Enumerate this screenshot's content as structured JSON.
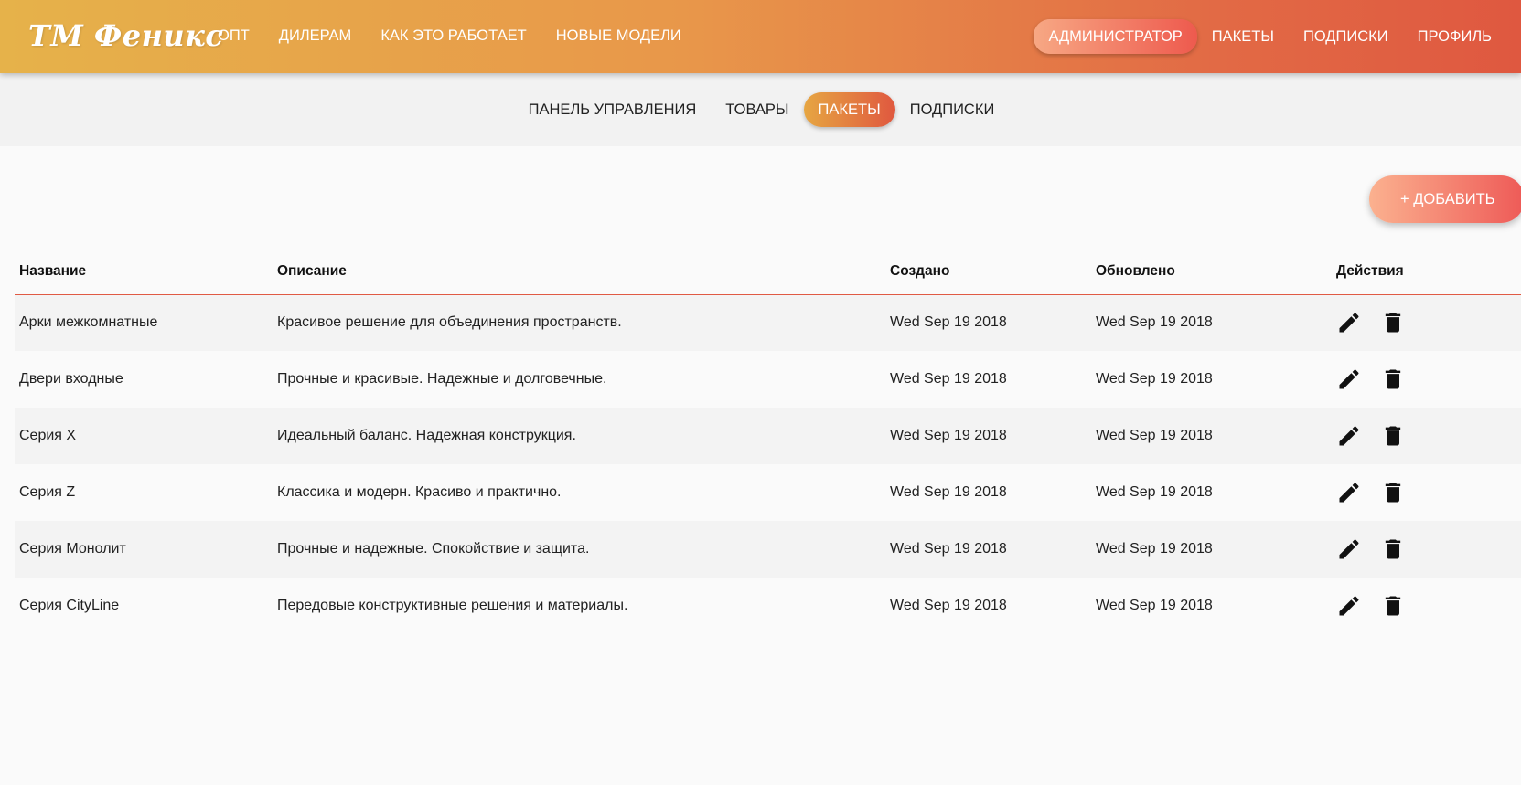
{
  "header": {
    "logo": "ТМ Феникс",
    "nav_left": [
      {
        "label": "ОПТ"
      },
      {
        "label": "ДИЛЕРАМ"
      },
      {
        "label": "КАК ЭТО РАБОТАЕТ"
      },
      {
        "label": "НОВЫЕ МОДЕЛИ"
      }
    ],
    "nav_right": [
      {
        "label": "АДМИНИСТРАТОР",
        "active": true
      },
      {
        "label": "ПАКЕТЫ"
      },
      {
        "label": "ПОДПИСКИ"
      },
      {
        "label": "ПРОФИЛЬ"
      }
    ]
  },
  "subnav": {
    "tabs": [
      {
        "label": "ПАНЕЛЬ УПРАВЛЕНИЯ"
      },
      {
        "label": "ТОВАРЫ"
      },
      {
        "label": "ПАКЕТЫ",
        "active": true
      },
      {
        "label": "ПОДПИСКИ"
      }
    ]
  },
  "toolbar": {
    "add_label": "+ ДОБАВИТЬ"
  },
  "table": {
    "columns": [
      "Название",
      "Описание",
      "Создано",
      "Обновлено",
      "Действия"
    ],
    "rows": [
      {
        "name": "Арки межкомнатные",
        "description": "Красивое решение для объединения пространств.",
        "created": "Wed Sep 19 2018",
        "updated": "Wed Sep 19 2018"
      },
      {
        "name": "Двери входные",
        "description": "Прочные и красивые. Надежные и долговечные.",
        "created": "Wed Sep 19 2018",
        "updated": "Wed Sep 19 2018"
      },
      {
        "name": "Серия X",
        "description": "Идеальный баланс. Надежная конструкция.",
        "created": "Wed Sep 19 2018",
        "updated": "Wed Sep 19 2018"
      },
      {
        "name": "Серия Z",
        "description": "Классика и модерн. Красиво и практично.",
        "created": "Wed Sep 19 2018",
        "updated": "Wed Sep 19 2018"
      },
      {
        "name": "Серия Монолит",
        "description": "Прочные и надежные. Спокойствие и защита.",
        "created": "Wed Sep 19 2018",
        "updated": "Wed Sep 19 2018"
      },
      {
        "name": "Серия CityLine",
        "description": "Передовые конструктивные решения и материалы.",
        "created": "Wed Sep 19 2018",
        "updated": "Wed Sep 19 2018"
      }
    ],
    "row_icons": [
      "pencil-icon",
      "trash-icon"
    ]
  },
  "colors": {
    "header_gradient_start": "#e6b24a",
    "header_gradient_end": "#df5840",
    "accent": "#e05a44"
  }
}
